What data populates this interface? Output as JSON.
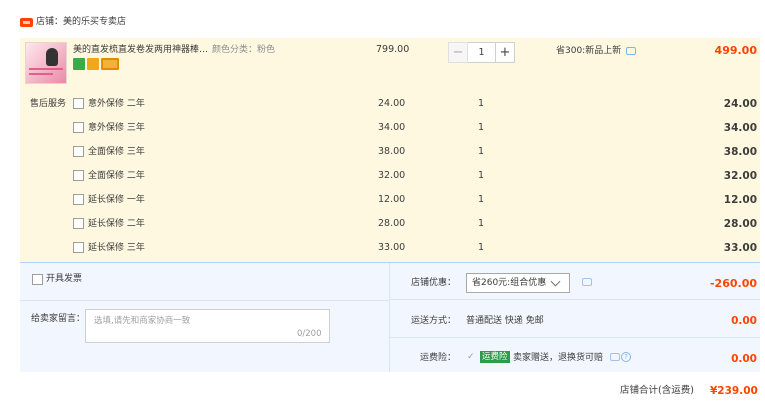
{
  "shop": {
    "name": "店铺：美的乐买专卖店"
  },
  "item": {
    "title": "美的直发梳直发卷发两用神器棒…",
    "spec": "颜色分类：粉色",
    "unit_price": "799.00",
    "quantity": "1",
    "qty_minus": "−",
    "qty_plus": "+",
    "promo": "省300:新品上新",
    "total": "499.00",
    "tags": [
      "7",
      "◆",
      "▬"
    ]
  },
  "services": {
    "heading": "售后服务",
    "rows": [
      {
        "name": "意外保修 二年",
        "price": "24.00",
        "qty": "1",
        "total": "24.00"
      },
      {
        "name": "意外保修 三年",
        "price": "34.00",
        "qty": "1",
        "total": "34.00"
      },
      {
        "name": "全面保修 三年",
        "price": "38.00",
        "qty": "1",
        "total": "38.00"
      },
      {
        "name": "全面保修 二年",
        "price": "32.00",
        "qty": "1",
        "total": "32.00"
      },
      {
        "name": "延长保修 一年",
        "price": "12.00",
        "qty": "1",
        "total": "12.00"
      },
      {
        "name": "延长保修 二年",
        "price": "28.00",
        "qty": "1",
        "total": "28.00"
      },
      {
        "name": "延长保修 三年",
        "price": "33.00",
        "qty": "1",
        "total": "33.00"
      }
    ]
  },
  "invoice": {
    "label": "开具发票"
  },
  "message": {
    "label": "给卖家留言：",
    "placeholder": "选填,请先和商家协商一致",
    "count": "0/200"
  },
  "discount": {
    "label": "店铺优惠：",
    "selected": "省260元:组合优惠",
    "amount": "-260.00"
  },
  "shipping": {
    "label": "运送方式：",
    "value": "普通配送 快递 免邮",
    "amount": "0.00"
  },
  "insurance": {
    "label": "运费险：",
    "badge": "运费险",
    "desc": "卖家赠送，退换货可赔",
    "amount": "0.00"
  },
  "total": {
    "label": "店铺合计(含运费)",
    "amount": "¥239.00"
  },
  "colors": {
    "accent": "#ff4400",
    "panel": "#f2f7ff",
    "item_bg": "#fff8e1"
  }
}
